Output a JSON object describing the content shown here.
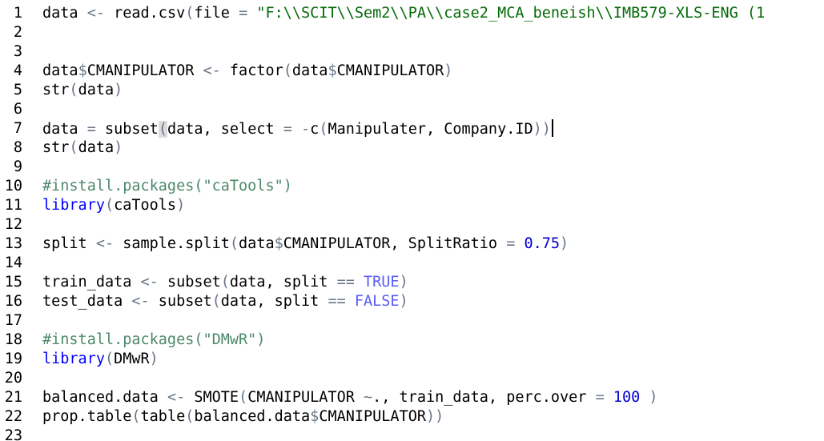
{
  "editor": {
    "lines": [
      {
        "n": "1",
        "tokens": [
          {
            "t": "data ",
            "c": "var"
          },
          {
            "t": "<-",
            "c": "op"
          },
          {
            "t": " read.csv",
            "c": "var"
          },
          {
            "t": "(",
            "c": "paren"
          },
          {
            "t": "file ",
            "c": "var"
          },
          {
            "t": "=",
            "c": "op"
          },
          {
            "t": " ",
            "c": "var"
          },
          {
            "t": "\"F:\\\\SCIT\\\\Sem2\\\\PA\\\\case2_MCA_beneish\\\\IMB579-XLS-ENG (1",
            "c": "str"
          }
        ]
      },
      {
        "n": "2",
        "tokens": []
      },
      {
        "n": "3",
        "tokens": []
      },
      {
        "n": "4",
        "tokens": [
          {
            "t": "data",
            "c": "var"
          },
          {
            "t": "$",
            "c": "op"
          },
          {
            "t": "CMANIPULATOR ",
            "c": "var"
          },
          {
            "t": "<-",
            "c": "op"
          },
          {
            "t": " factor",
            "c": "var"
          },
          {
            "t": "(",
            "c": "paren"
          },
          {
            "t": "data",
            "c": "var"
          },
          {
            "t": "$",
            "c": "op"
          },
          {
            "t": "CMANIPULATOR",
            "c": "var"
          },
          {
            "t": ")",
            "c": "paren"
          }
        ]
      },
      {
        "n": "5",
        "tokens": [
          {
            "t": "str",
            "c": "var"
          },
          {
            "t": "(",
            "c": "paren"
          },
          {
            "t": "data",
            "c": "var"
          },
          {
            "t": ")",
            "c": "paren"
          }
        ]
      },
      {
        "n": "6",
        "tokens": []
      },
      {
        "n": "7",
        "tokens": [
          {
            "t": "data ",
            "c": "var"
          },
          {
            "t": "=",
            "c": "op"
          },
          {
            "t": " subset",
            "c": "var"
          },
          {
            "t": "(",
            "c": "paren-hl"
          },
          {
            "t": "data, select ",
            "c": "var"
          },
          {
            "t": "=",
            "c": "op"
          },
          {
            "t": " ",
            "c": "var"
          },
          {
            "t": "-",
            "c": "op"
          },
          {
            "t": "c",
            "c": "var"
          },
          {
            "t": "(",
            "c": "paren"
          },
          {
            "t": "Manipulater, Company.ID",
            "c": "var"
          },
          {
            "t": ")",
            "c": "paren"
          },
          {
            "t": ")",
            "c": "paren"
          },
          {
            "t": "",
            "c": "caret"
          }
        ]
      },
      {
        "n": "8",
        "tokens": [
          {
            "t": "str",
            "c": "var"
          },
          {
            "t": "(",
            "c": "paren"
          },
          {
            "t": "data",
            "c": "var"
          },
          {
            "t": ")",
            "c": "paren"
          }
        ]
      },
      {
        "n": "9",
        "tokens": []
      },
      {
        "n": "10",
        "tokens": [
          {
            "t": "#install.packages(\"caTools\")",
            "c": "comment"
          }
        ]
      },
      {
        "n": "11",
        "tokens": [
          {
            "t": "library",
            "c": "kw"
          },
          {
            "t": "(",
            "c": "paren"
          },
          {
            "t": "caTools",
            "c": "var"
          },
          {
            "t": ")",
            "c": "paren"
          }
        ]
      },
      {
        "n": "12",
        "tokens": []
      },
      {
        "n": "13",
        "tokens": [
          {
            "t": "split ",
            "c": "var"
          },
          {
            "t": "<-",
            "c": "op"
          },
          {
            "t": " sample.split",
            "c": "var"
          },
          {
            "t": "(",
            "c": "paren"
          },
          {
            "t": "data",
            "c": "var"
          },
          {
            "t": "$",
            "c": "op"
          },
          {
            "t": "CMANIPULATOR, SplitRatio ",
            "c": "var"
          },
          {
            "t": "=",
            "c": "op"
          },
          {
            "t": " ",
            "c": "var"
          },
          {
            "t": "0.75",
            "c": "num"
          },
          {
            "t": ")",
            "c": "paren"
          }
        ]
      },
      {
        "n": "14",
        "tokens": []
      },
      {
        "n": "15",
        "tokens": [
          {
            "t": "train_data ",
            "c": "var"
          },
          {
            "t": "<-",
            "c": "op"
          },
          {
            "t": " subset",
            "c": "var"
          },
          {
            "t": "(",
            "c": "paren"
          },
          {
            "t": "data, split ",
            "c": "var"
          },
          {
            "t": "==",
            "c": "op"
          },
          {
            "t": " ",
            "c": "var"
          },
          {
            "t": "TRUE",
            "c": "const"
          },
          {
            "t": ")",
            "c": "paren"
          }
        ]
      },
      {
        "n": "16",
        "tokens": [
          {
            "t": "test_data ",
            "c": "var"
          },
          {
            "t": "<-",
            "c": "op"
          },
          {
            "t": " subset",
            "c": "var"
          },
          {
            "t": "(",
            "c": "paren"
          },
          {
            "t": "data, split ",
            "c": "var"
          },
          {
            "t": "==",
            "c": "op"
          },
          {
            "t": " ",
            "c": "var"
          },
          {
            "t": "FALSE",
            "c": "const"
          },
          {
            "t": ")",
            "c": "paren"
          }
        ]
      },
      {
        "n": "17",
        "tokens": []
      },
      {
        "n": "18",
        "tokens": [
          {
            "t": "#install.packages(\"DMwR\")",
            "c": "comment"
          }
        ]
      },
      {
        "n": "19",
        "tokens": [
          {
            "t": "library",
            "c": "kw"
          },
          {
            "t": "(",
            "c": "paren"
          },
          {
            "t": "DMwR",
            "c": "var"
          },
          {
            "t": ")",
            "c": "paren"
          }
        ]
      },
      {
        "n": "20",
        "tokens": []
      },
      {
        "n": "21",
        "tokens": [
          {
            "t": "balanced.data ",
            "c": "var"
          },
          {
            "t": "<-",
            "c": "op"
          },
          {
            "t": " SMOTE",
            "c": "var"
          },
          {
            "t": "(",
            "c": "paren"
          },
          {
            "t": "CMANIPULATOR ",
            "c": "var"
          },
          {
            "t": "~",
            "c": "op"
          },
          {
            "t": "., train_data, perc.over ",
            "c": "var"
          },
          {
            "t": "=",
            "c": "op"
          },
          {
            "t": " ",
            "c": "var"
          },
          {
            "t": "100",
            "c": "num"
          },
          {
            "t": " ",
            "c": "var"
          },
          {
            "t": ")",
            "c": "paren"
          }
        ]
      },
      {
        "n": "22",
        "tokens": [
          {
            "t": "prop.table",
            "c": "var"
          },
          {
            "t": "(",
            "c": "paren"
          },
          {
            "t": "table",
            "c": "var"
          },
          {
            "t": "(",
            "c": "paren"
          },
          {
            "t": "balanced.data",
            "c": "var"
          },
          {
            "t": "$",
            "c": "op"
          },
          {
            "t": "CMANIPULATOR",
            "c": "var"
          },
          {
            "t": ")",
            "c": "paren"
          },
          {
            "t": ")",
            "c": "paren"
          }
        ]
      },
      {
        "n": "23",
        "tokens": []
      }
    ]
  }
}
